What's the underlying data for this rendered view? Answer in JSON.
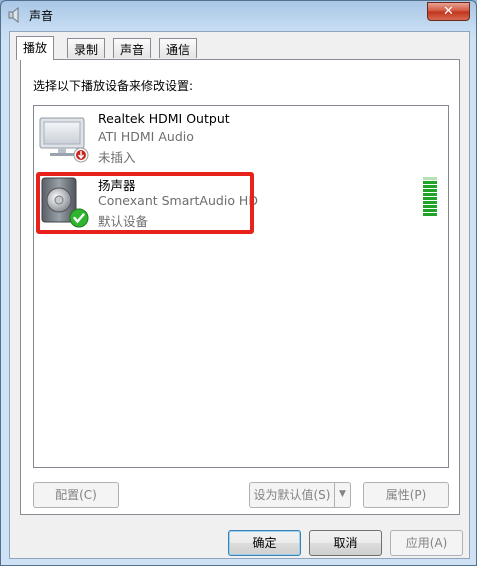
{
  "window": {
    "title": "声音",
    "close_label": "✕"
  },
  "tabs": [
    {
      "label": "播放",
      "active": true
    },
    {
      "label": "录制",
      "active": false
    },
    {
      "label": "声音",
      "active": false
    },
    {
      "label": "通信",
      "active": false
    }
  ],
  "playback": {
    "instruction": "选择以下播放设备来修改设置:",
    "devices": [
      {
        "name": "Realtek HDMI Output",
        "driver": "ATI HDMI Audio",
        "status": "未插入",
        "icon": "monitor-icon",
        "badge": "unplugged-badge-icon"
      },
      {
        "name": "扬声器",
        "driver": "Conexant SmartAudio HD",
        "status": "默认设备",
        "icon": "speaker-icon",
        "badge": "default-check-icon",
        "level_fraction": 0.85
      }
    ],
    "buttons": {
      "configure": "配置(C)",
      "set_default": "设为默认值(S)",
      "set_default_arrow": "▼",
      "properties": "属性(P)"
    }
  },
  "footer": {
    "ok": "确定",
    "cancel": "取消",
    "apply": "应用(A)"
  },
  "colors": {
    "highlight": "#e8221b",
    "meter": "#1fa329",
    "check": "#2fb52f"
  }
}
